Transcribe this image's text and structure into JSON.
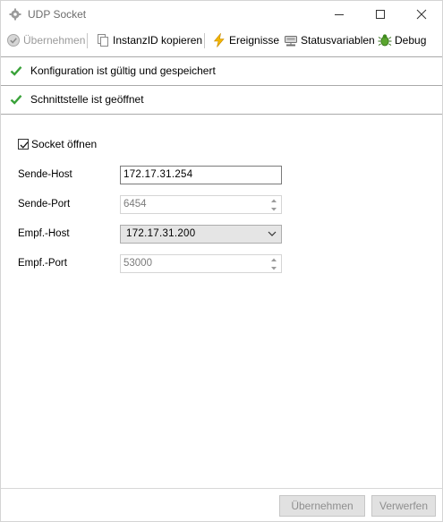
{
  "window": {
    "title": "UDP Socket",
    "icon": "gear-icon",
    "controls": [
      "minimize-icon",
      "maximize-icon",
      "close-icon"
    ]
  },
  "toolbar": {
    "apply": {
      "label": "Übernehmen",
      "icon": "check-circle-icon",
      "enabled": false
    },
    "copy_id": {
      "label": "InstanzID kopieren",
      "icon": "copy-icon",
      "enabled": true
    },
    "events": {
      "label": "Ereignisse",
      "icon": "lightning-icon",
      "enabled": true
    },
    "status_vars": {
      "label": "Statusvariablen",
      "icon": "network-icon",
      "enabled": true
    },
    "debug": {
      "label": "Debug",
      "icon": "bug-icon",
      "enabled": true
    }
  },
  "status": [
    {
      "text": "Konfiguration ist gültig und gespeichert",
      "icon": "checkmark-icon"
    },
    {
      "text": "Schnittstelle ist geöffnet",
      "icon": "checkmark-icon"
    }
  ],
  "form": {
    "open_socket": {
      "label": "Socket öffnen",
      "checked": true
    },
    "send_host": {
      "label": "Sende-Host",
      "value": "172.17.31.254"
    },
    "send_port": {
      "label": "Sende-Port",
      "value": "6454"
    },
    "recv_host": {
      "label": "Empf.-Host",
      "value": "172.17.31.200"
    },
    "recv_port": {
      "label": "Empf.-Port",
      "value": "53000"
    }
  },
  "footer": {
    "apply_label": "Übernehmen",
    "discard_label": "Verwerfen"
  },
  "colors": {
    "check_green": "#3aa23a",
    "disabled_text": "#9a9a9a",
    "event_yellow": "#f0b400",
    "debug_green": "#4a9a2a"
  }
}
